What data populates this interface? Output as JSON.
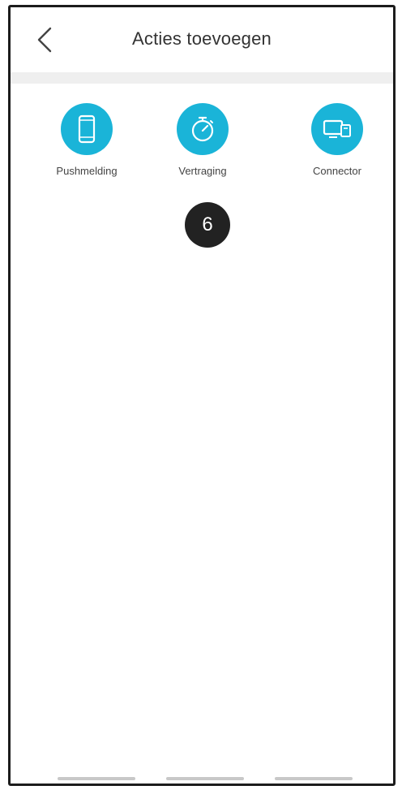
{
  "header": {
    "title": "Acties toevoegen",
    "back_icon": "chevron-left-icon"
  },
  "actions": [
    {
      "label": "Pushmelding",
      "icon": "smartphone-icon"
    },
    {
      "label": "Vertraging",
      "icon": "stopwatch-icon"
    },
    {
      "label": "Connector",
      "icon": "connector-icon"
    }
  ],
  "badge": {
    "value": "6"
  },
  "colors": {
    "accent": "#1ab4d8",
    "badge_bg": "#222222",
    "divider": "#efefef"
  }
}
